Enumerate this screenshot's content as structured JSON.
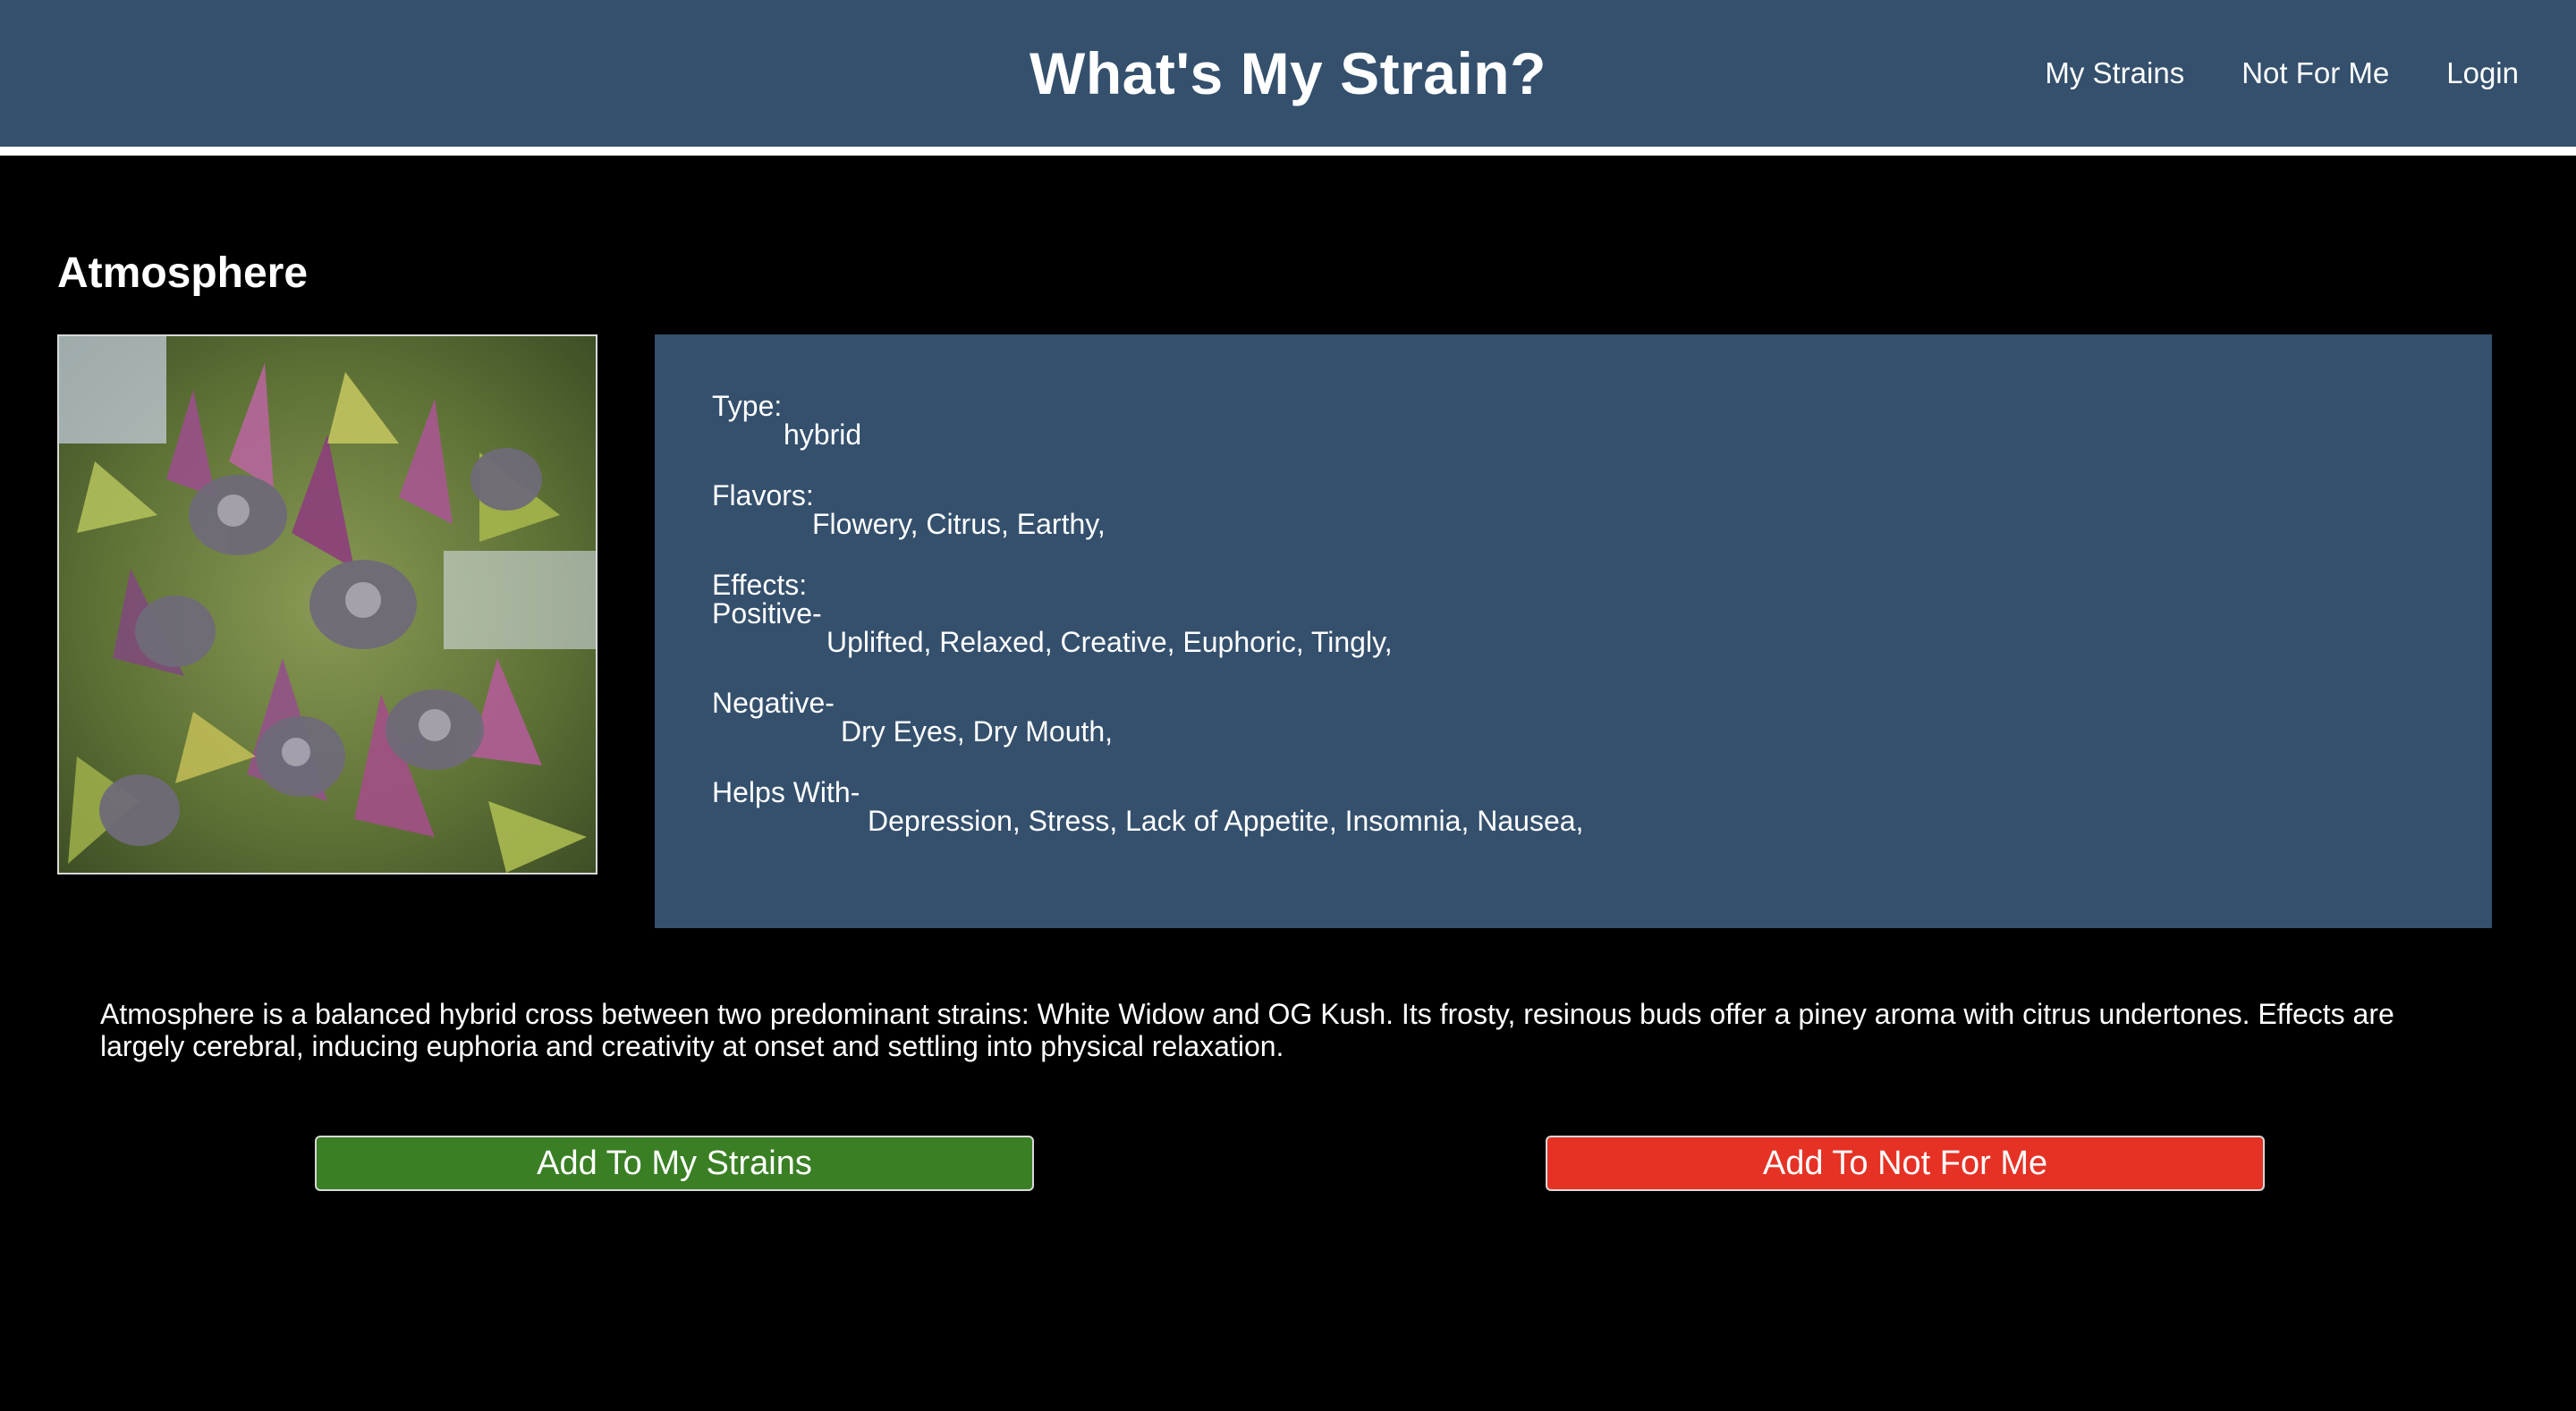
{
  "header": {
    "title": "What's My Strain?",
    "nav": [
      "My Strains",
      "Not For Me",
      "Login"
    ]
  },
  "strain": {
    "name": "Atmosphere",
    "image_icon": "cannabis-plant-photo",
    "type_label": "Type:",
    "type_value": "hybrid",
    "flavors_label": "Flavors:",
    "flavors_value": "Flowery, Citrus, Earthy,",
    "effects_label": "Effects:",
    "positive_label": "Positive-",
    "positive_value": "Uplifted, Relaxed, Creative, Euphoric, Tingly,",
    "negative_label": "Negative-",
    "negative_value": "Dry Eyes, Dry Mouth,",
    "helps_label": "Helps With-",
    "helps_value": "Depression, Stress, Lack of Appetite, Insomnia, Nausea,",
    "description": "Atmosphere is a balanced hybrid cross between two predominant strains: White Widow and OG Kush. Its frosty, resinous buds offer a piney aroma with citrus undertones. Effects are largely cerebral, inducing euphoria and creativity at onset and settling into physical relaxation."
  },
  "actions": {
    "add_my_strains": "Add To My Strains",
    "add_not_for_me": "Add To Not For Me"
  },
  "colors": {
    "header_bg": "#34506d",
    "panel_bg": "#34506d",
    "page_bg": "#000000",
    "add_button": "#3a7f24",
    "not_for_me_button": "#e53225"
  }
}
